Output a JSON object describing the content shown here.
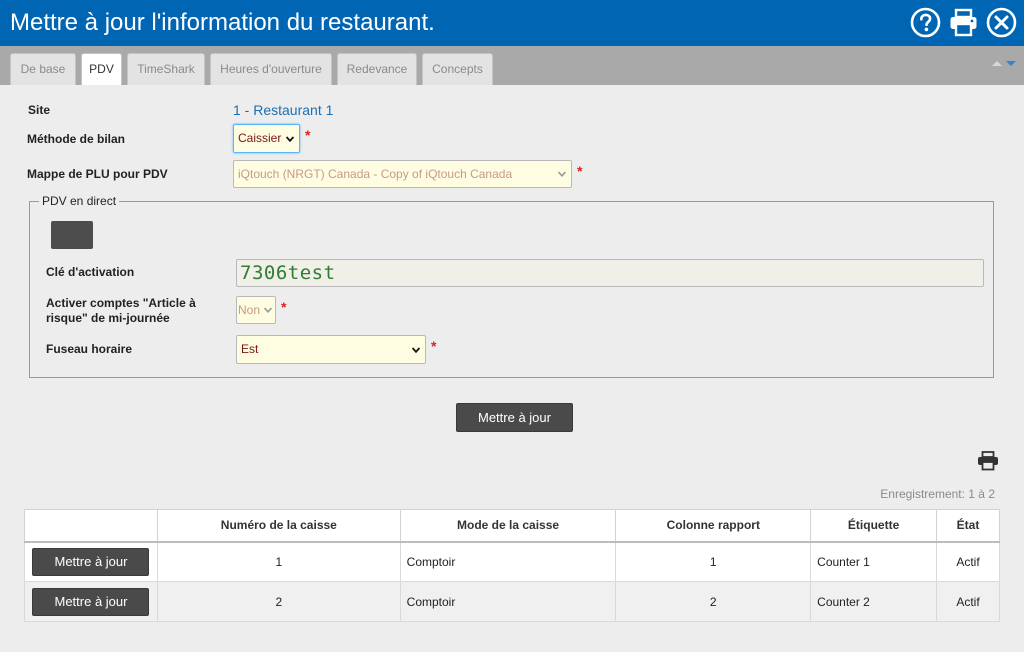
{
  "window": {
    "title": "Mettre à jour l'information du restaurant.",
    "icons": [
      "help-icon",
      "print-icon",
      "close-icon"
    ]
  },
  "tabs": [
    {
      "label": "De base",
      "active": false
    },
    {
      "label": "PDV",
      "active": true
    },
    {
      "label": "TimeShark",
      "active": false
    },
    {
      "label": "Heures d'ouverture",
      "active": false
    },
    {
      "label": "Redevance",
      "active": false
    },
    {
      "label": "Concepts",
      "active": false
    }
  ],
  "form": {
    "site_label": "Site",
    "site_value": "1 - Restaurant 1",
    "method_label": "Méthode de bilan",
    "method_value": "Caissier",
    "plu_label": "Mappe de PLU pour PDV",
    "plu_value": "iQtouch (NRGT) Canada - Copy of iQtouch Canada",
    "required_mark": "*"
  },
  "live_pos": {
    "legend": "PDV en direct",
    "key_label": "Clé d'activation",
    "key_value": "7306test",
    "risk_label": "Activer comptes \"Article à risque\" de mi-journée",
    "risk_value": "Non",
    "tz_label": "Fuseau horaire",
    "tz_value": "Est"
  },
  "update_button": "Mettre à jour",
  "records_text": "Enregistrement: 1 à 2",
  "table": {
    "headers": [
      "",
      "Numéro de la caisse",
      "Mode de la caisse",
      "Colonne rapport",
      "Étiquette",
      "État"
    ],
    "rows": [
      {
        "button": "Mettre à jour",
        "number": "1",
        "mode": "Comptoir",
        "column": "1",
        "label": "Counter 1",
        "state": "Actif"
      },
      {
        "button": "Mettre à jour",
        "number": "2",
        "mode": "Comptoir",
        "column": "2",
        "label": "Counter 2",
        "state": "Actif"
      }
    ]
  },
  "colors": {
    "titlebar": "#0066b3",
    "accent_link": "#1a6fb3",
    "required": "#e02020",
    "button": "#4a4a4a"
  }
}
